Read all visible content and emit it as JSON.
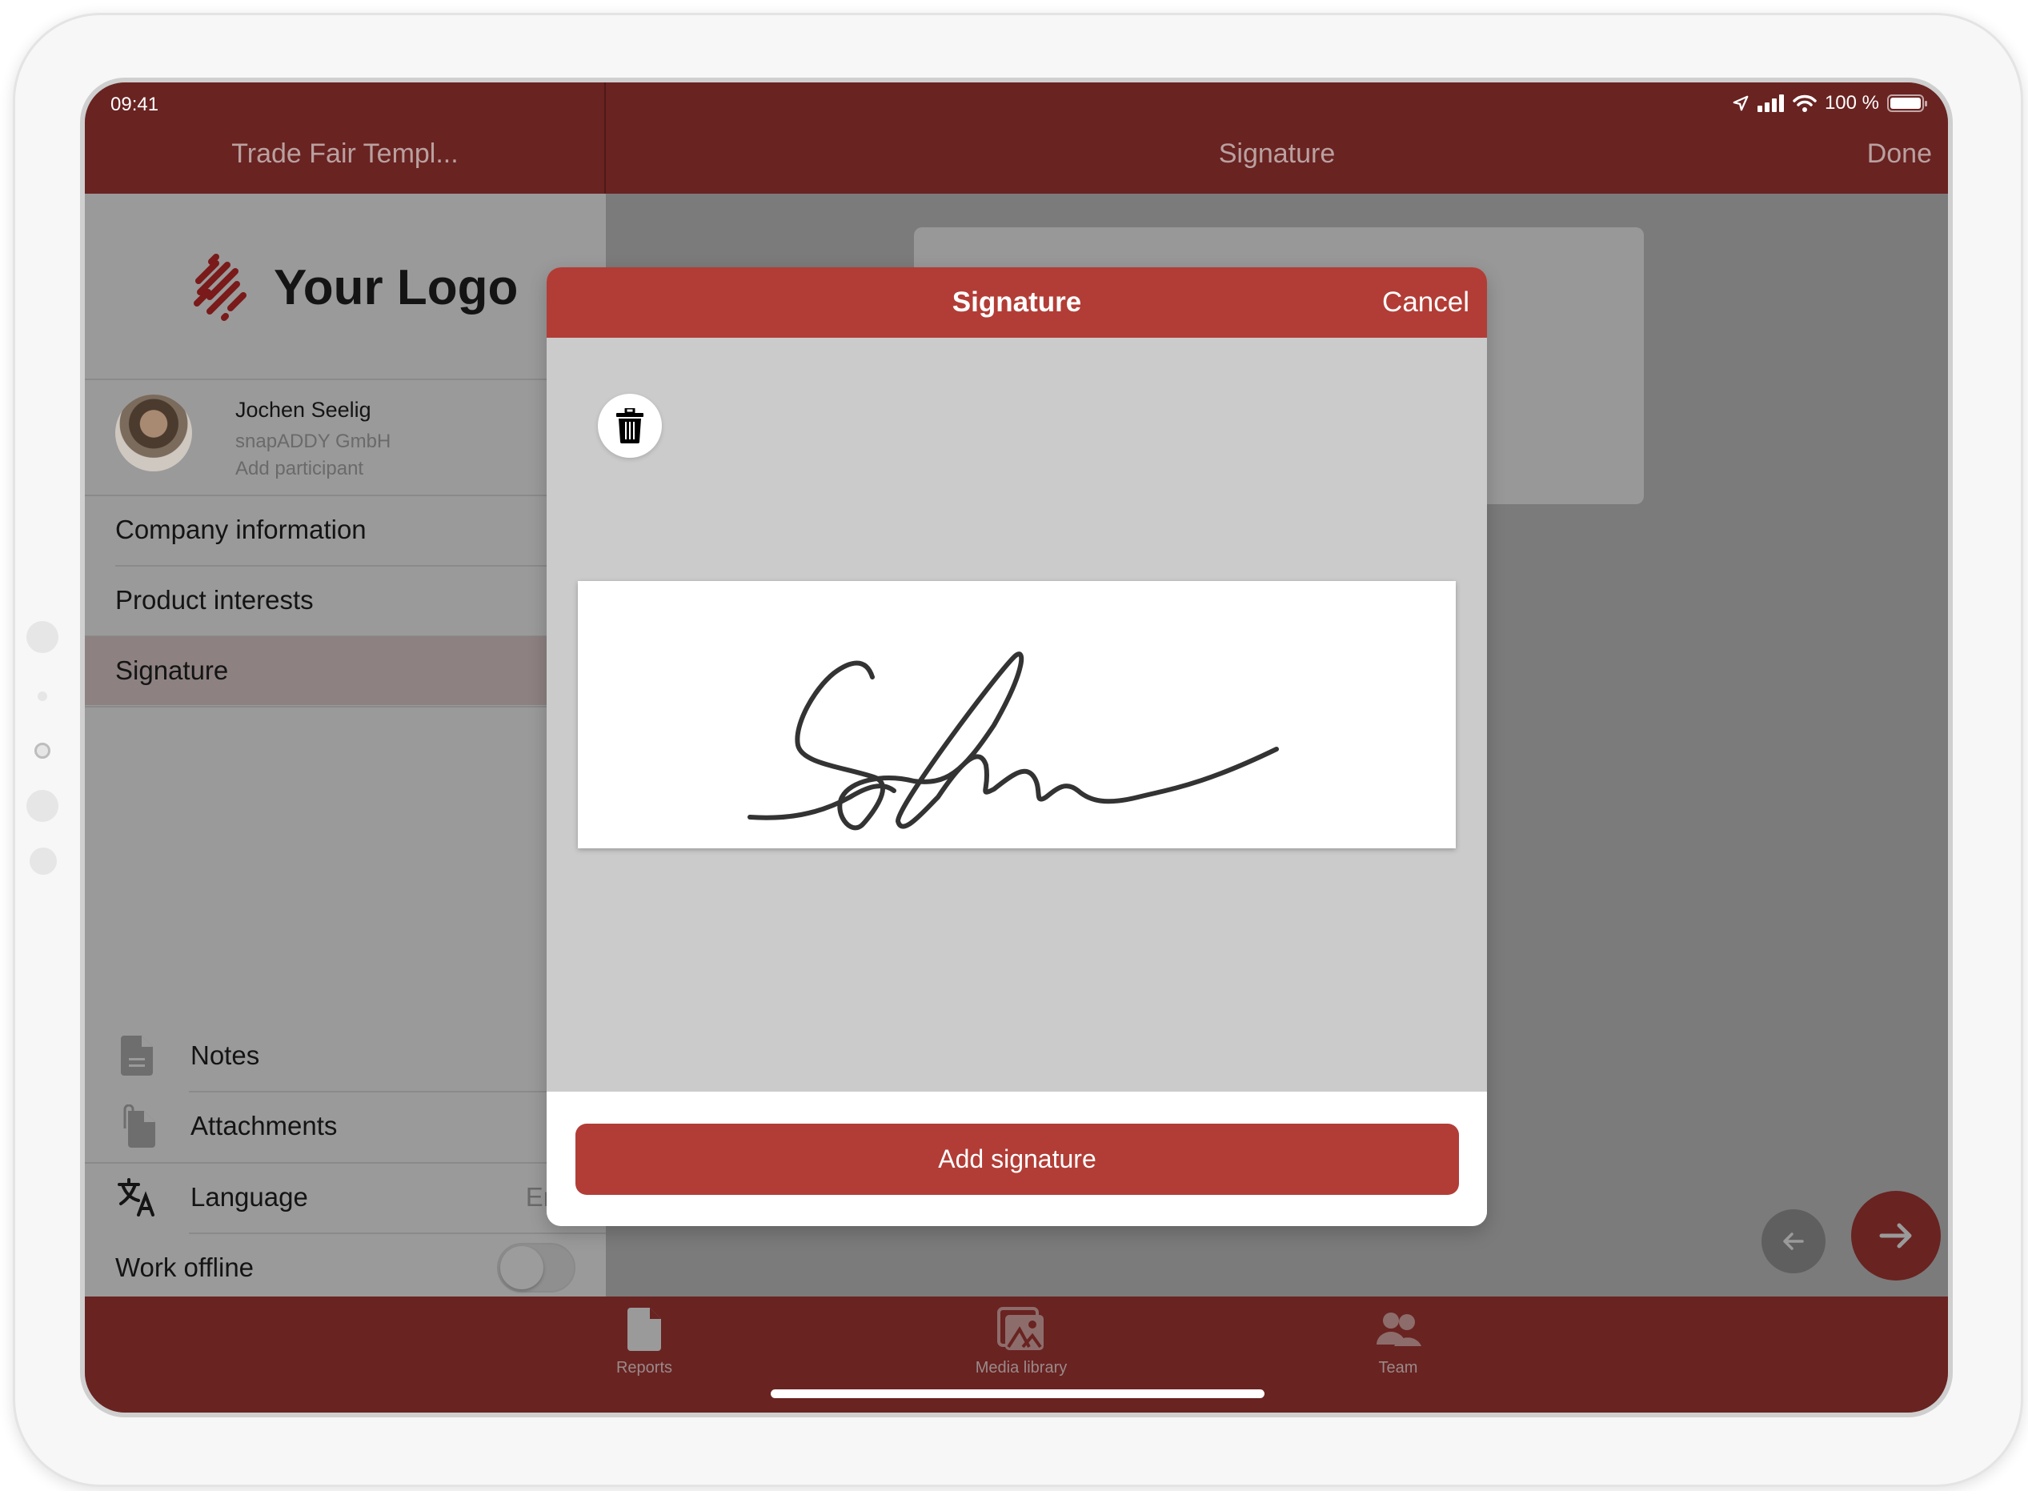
{
  "status_bar": {
    "time": "09:41",
    "battery_text": "100 %",
    "icons": [
      "location-arrow-icon",
      "cellular-signal-icon",
      "wifi-icon",
      "battery-icon"
    ]
  },
  "header": {
    "left_title": "Trade Fair Templ...",
    "title": "Signature",
    "done_label": "Done"
  },
  "sidebar": {
    "logo_text": "Your Logo",
    "participant": {
      "name": "Jochen Seelig",
      "company": "snapADDY GmbH",
      "add_label": "Add participant"
    },
    "nav_items": [
      {
        "label": "Company information",
        "active": false
      },
      {
        "label": "Product interests",
        "active": false
      },
      {
        "label": "Signature",
        "active": true
      }
    ],
    "tools": [
      {
        "label": "Notes",
        "icon": "document-icon"
      },
      {
        "label": "Attachments",
        "icon": "attachment-icon"
      }
    ],
    "language": {
      "label": "Language",
      "value": "English",
      "icon": "translate-icon"
    },
    "work_offline": {
      "label": "Work offline",
      "enabled": false
    }
  },
  "modal": {
    "title": "Signature",
    "cancel_label": "Cancel",
    "clear_icon": "trash-icon",
    "add_button_label": "Add signature"
  },
  "tabbar": {
    "tabs": [
      {
        "label": "Reports",
        "icon": "document-icon"
      },
      {
        "label": "Media library",
        "icon": "image-gallery-icon"
      },
      {
        "label": "Team",
        "icon": "people-icon"
      }
    ]
  },
  "colors": {
    "brand_dark": "#692321",
    "brand": "#b23d36",
    "overlay_gray": "#7b7b7b"
  }
}
